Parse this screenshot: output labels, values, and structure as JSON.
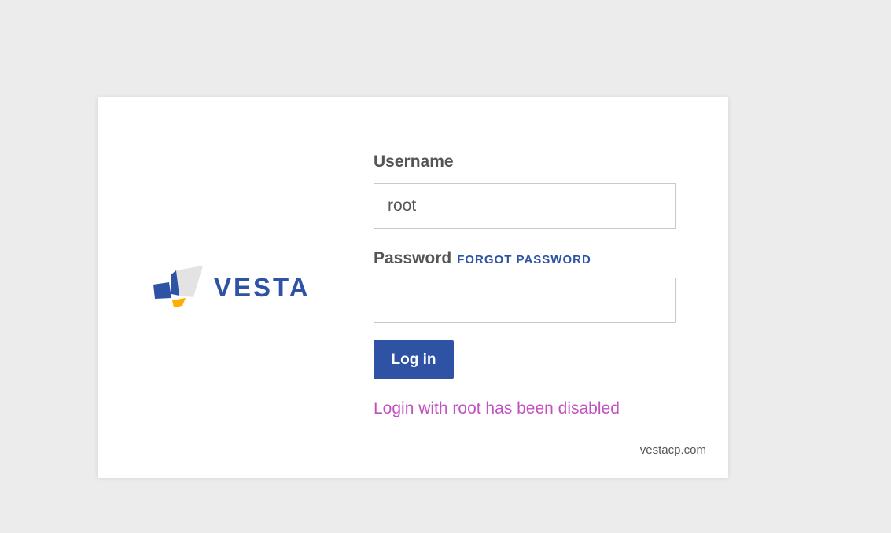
{
  "brand": {
    "logo_text": "VESTA",
    "colors": {
      "primary_blue": "#2e53a5",
      "accent_orange": "#ffad00",
      "light_gray_shape": "#e3e3e3"
    }
  },
  "form": {
    "username_label": "Username",
    "username_value": "root",
    "password_label": "Password",
    "forgot_password_label": "FORGOT PASSWORD",
    "password_value": "",
    "login_button_label": "Log in",
    "error_message": "Login with root has been disabled"
  },
  "footer": {
    "link_text": "vestacp.com"
  },
  "colors": {
    "background": "#ececec",
    "card": "#ffffff",
    "error": "#c151c1",
    "label": "#555555"
  }
}
